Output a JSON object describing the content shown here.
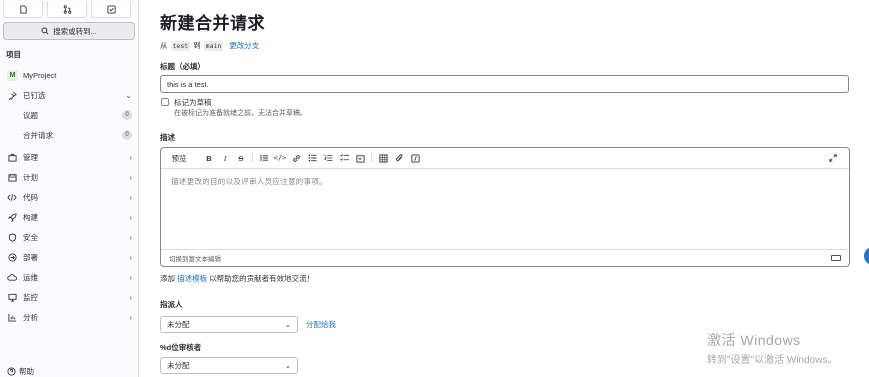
{
  "sidebar": {
    "search_label": "搜索或转到...",
    "section_title": "项目",
    "project_avatar_letter": "M",
    "project_name": "MyProject",
    "pinned": {
      "label": "已钉选",
      "items": [
        {
          "label": "议题",
          "count": "0"
        },
        {
          "label": "合并请求",
          "count": "0"
        }
      ]
    },
    "nav": [
      {
        "label": "管理",
        "icon": "briefcase-icon"
      },
      {
        "label": "计划",
        "icon": "calendar-icon"
      },
      {
        "label": "代码",
        "icon": "code-icon"
      },
      {
        "label": "构建",
        "icon": "rocket-icon"
      },
      {
        "label": "安全",
        "icon": "shield-icon"
      },
      {
        "label": "部署",
        "icon": "deploy-icon"
      },
      {
        "label": "运维",
        "icon": "cloud-icon"
      },
      {
        "label": "监控",
        "icon": "monitor-icon"
      },
      {
        "label": "分析",
        "icon": "chart-icon"
      }
    ],
    "help_label": "帮助"
  },
  "main": {
    "title": "新建合并请求",
    "branch": {
      "from_word": "从",
      "source": "test",
      "to_word": "到",
      "target": "main",
      "change_link": "更改分支"
    },
    "title_field": {
      "label": "标题（必填）",
      "value": "this is a test."
    },
    "draft": {
      "label": "标记为草稿",
      "help": "在被标记为准备就绪之前，无法合并草稿。"
    },
    "description": {
      "label": "描述",
      "preview_tab": "预览",
      "placeholder": "描述更改的目的以及评审人员应注意的事项。",
      "switch_editor": "切换到富文本编辑"
    },
    "template_line": {
      "prefix": "添加",
      "link": "描述模板",
      "suffix": "以帮助您的贡献者有效地交流！"
    },
    "assignee": {
      "label": "指派人",
      "value": "未分配",
      "assign_me": "分配给我"
    },
    "reviewer": {
      "label": "%d位审核者",
      "value": "未分配"
    }
  },
  "watermark": {
    "line1": "激活 Windows",
    "line2": "转到\"设置\"以激活 Windows。"
  },
  "colors": {
    "link": "#1f75cb",
    "sidebar_bg": "#fbfafd",
    "accent": "#1f75cb"
  }
}
